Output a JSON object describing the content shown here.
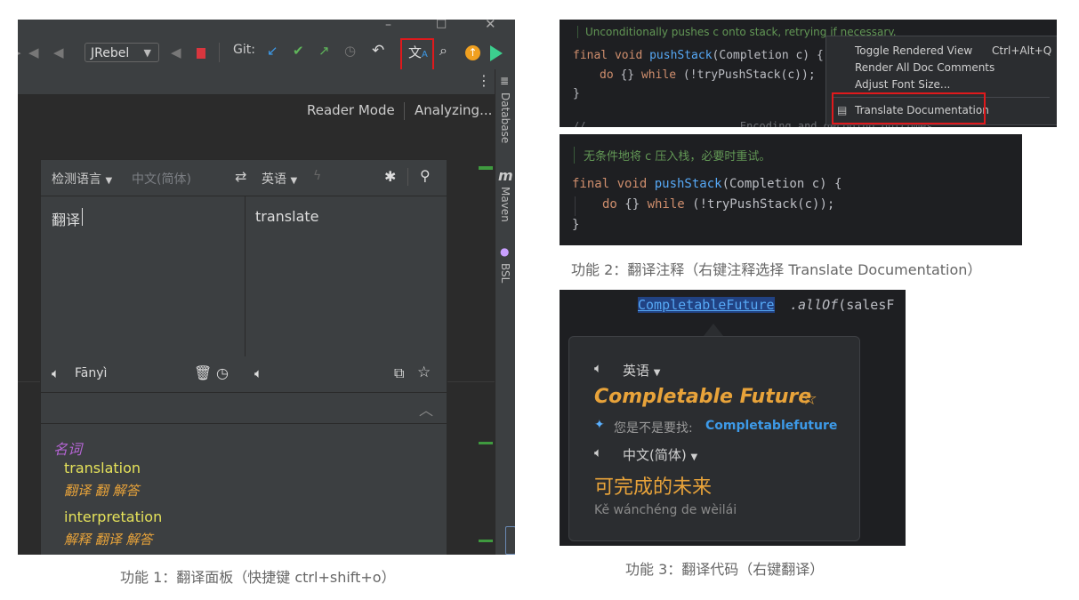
{
  "panel1": {
    "toolbar": {
      "jrebel": "JRebel",
      "git": "Git:"
    },
    "tabsbar": {
      "reader_mode": "Reader Mode",
      "analyzing": "Analyzing..."
    },
    "side_tools": {
      "database": "Database",
      "maven": "Maven",
      "maven_glyph": "m",
      "bsl": "BSL"
    },
    "popup": {
      "source_lang": "检测语言",
      "source_lang_hint": "中文(简体)",
      "target_lang": "英语",
      "source_text": "翻译",
      "target_text": "translate",
      "phonetic": "Fānyì",
      "dictionary": {
        "part_of_speech": "名词",
        "entries": [
          {
            "word": "translation",
            "meanings": "翻译 翻 解答"
          },
          {
            "word": "interpretation",
            "meanings": "解释 翻译 解答"
          }
        ]
      }
    },
    "caption": "功能 1：翻译面板（快捷键 ctrl+shift+o）"
  },
  "panel2": {
    "top": {
      "comment": "Unconditionally pushes c onto stack, retrying if necessary.",
      "code": {
        "l1_kw": "final void ",
        "l1_fn": "pushStack",
        "l1_rest": "(Completion c) {",
        "l2_kw": "do",
        "l2_mid": " {} ",
        "l2_kw2": "while",
        "l2_rest": " (!tryPushStack(c));",
        "l3": "}",
        "l4": "// ...                    Encoding and decoding outcomes                     ..."
      },
      "menu": {
        "items": [
          {
            "label": "Toggle Rendered View",
            "shortcut": "Ctrl+Alt+Q"
          },
          {
            "label": "Render All Doc Comments",
            "shortcut": ""
          },
          {
            "label": "Adjust Font Size...",
            "shortcut": ""
          },
          {
            "label": "Translate Documentation",
            "shortcut": ""
          }
        ]
      }
    },
    "bottom": {
      "comment": "无条件地将 c 压入栈，必要时重试。",
      "code": {
        "l1_kw": "final void ",
        "l1_fn": "pushStack",
        "l1_rest": "(Completion c) {",
        "l2_kw": "do",
        "l2_mid": " {} ",
        "l2_kw2": "while",
        "l2_rest": " (!tryPushStack(c));",
        "l3": "}"
      }
    },
    "caption": "功能 2：翻译注释（右键注释选择 Translate Documentation）"
  },
  "panel3": {
    "code_line": {
      "class_name": "CompletableFuture",
      "rest_italic": ".allOf",
      "rest": "(salesF"
    },
    "tooltip": {
      "source_lang": "英语",
      "source_text": "Completable Future",
      "suggest_prefix": "您是不是要找: ",
      "suggest_word": "Completablefuture",
      "target_lang": "中文(简体)",
      "target_text": "可完成的未来",
      "phonetic": "Kě wánchéng de wèilái"
    },
    "caption": "功能 3：翻译代码（右键翻译）"
  },
  "colors": {
    "highlight_red": "#e0191c",
    "keyword_orange": "#cf8e6d",
    "comment_green": "#629755",
    "suggest_blue": "#3d9ae8",
    "dict_yellow": "#e5e25a",
    "dict_orange": "#e8a33a",
    "pos_purple": "#b565d4"
  }
}
